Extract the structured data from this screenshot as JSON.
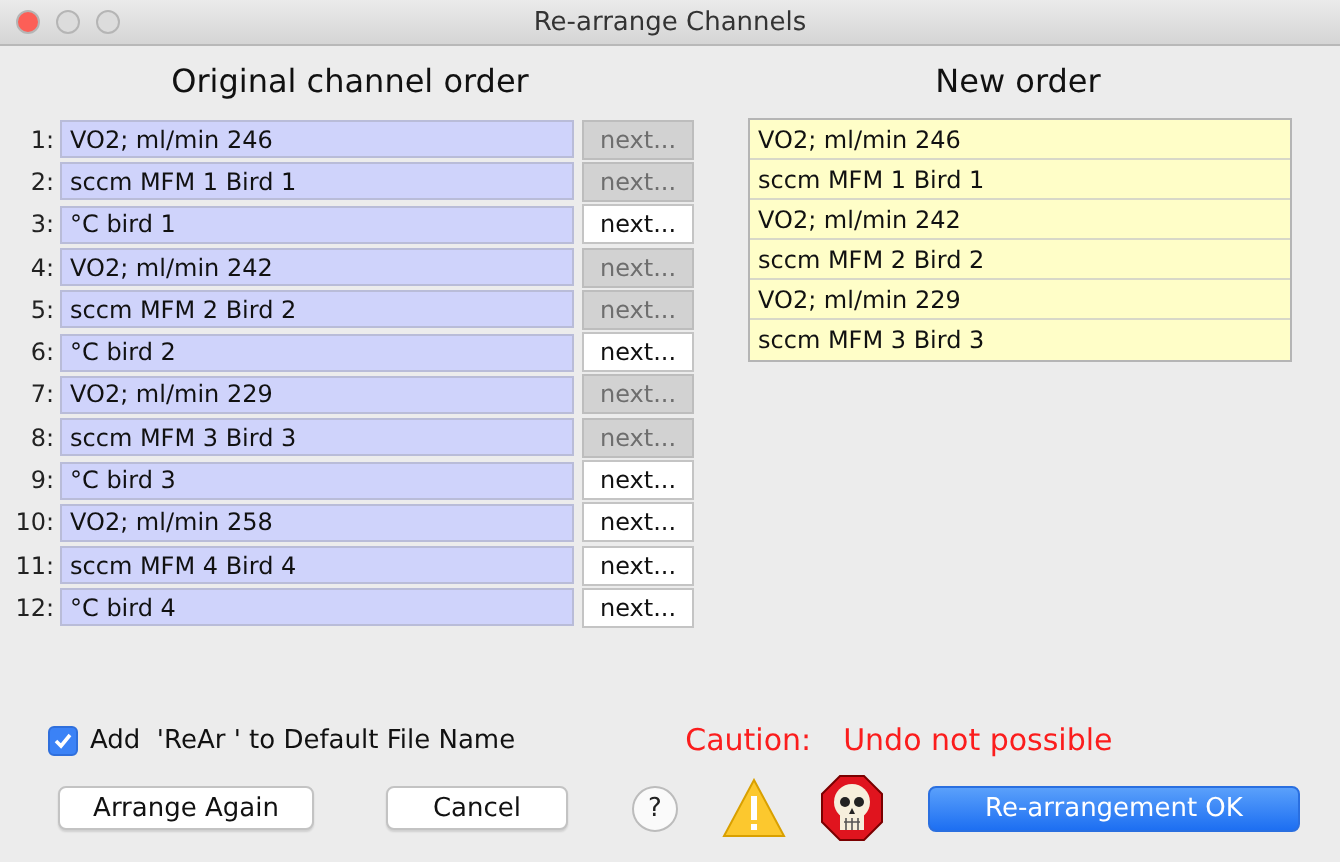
{
  "window": {
    "title": "Re-arrange Channels"
  },
  "original": {
    "heading": "Original channel order",
    "rows": [
      {
        "number": "1:",
        "name": "VO2; ml/min 246",
        "button": "next...",
        "disabled": true
      },
      {
        "number": "2:",
        "name": "sccm MFM 1 Bird 1",
        "button": "next...",
        "disabled": true
      },
      {
        "number": "3:",
        "name": "°C bird 1",
        "button": "next...",
        "disabled": false
      },
      {
        "number": "4:",
        "name": "VO2; ml/min 242",
        "button": "next...",
        "disabled": true
      },
      {
        "number": "5:",
        "name": "sccm MFM 2 Bird 2",
        "button": "next...",
        "disabled": true
      },
      {
        "number": "6:",
        "name": "°C bird 2",
        "button": "next...",
        "disabled": false
      },
      {
        "number": "7:",
        "name": "VO2; ml/min 229",
        "button": "next...",
        "disabled": true
      },
      {
        "number": "8:",
        "name": "sccm MFM 3 Bird 3",
        "button": "next...",
        "disabled": true
      },
      {
        "number": "9:",
        "name": "°C bird 3",
        "button": "next...",
        "disabled": false
      },
      {
        "number": "10:",
        "name": "VO2; ml/min 258",
        "button": "next...",
        "disabled": false
      },
      {
        "number": "11:",
        "name": "sccm MFM 4 Bird 4",
        "button": "next...",
        "disabled": false
      },
      {
        "number": "12:",
        "name": "°C bird 4",
        "button": "next...",
        "disabled": false
      }
    ]
  },
  "new_order": {
    "heading": "New order",
    "items": [
      "VO2; ml/min 246",
      "sccm MFM 1 Bird 1",
      "VO2; ml/min 242",
      "sccm MFM 2 Bird 2",
      "VO2; ml/min 229",
      "sccm MFM 3 Bird 3"
    ]
  },
  "option": {
    "label": "Add  'ReAr ' to Default File Name",
    "checked": true
  },
  "caution": {
    "label": "Caution:",
    "message": "Undo not possible"
  },
  "buttons": {
    "arrange_again": "Arrange Again",
    "cancel": "Cancel",
    "help": "?",
    "ok": "Re-arrangement OK"
  }
}
